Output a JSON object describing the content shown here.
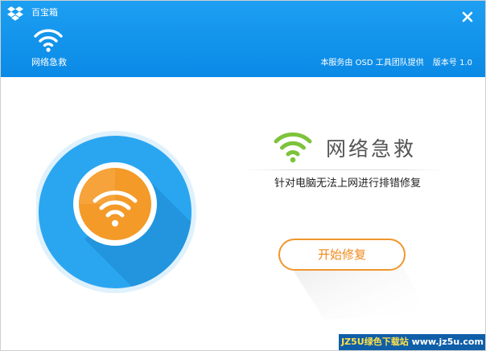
{
  "window": {
    "title": "百宝箱",
    "logo_icon": "dropbox-style-box-icon",
    "close_icon": "close-icon"
  },
  "header": {
    "tool": {
      "icon": "wifi-icon",
      "label": "网络急救"
    },
    "service_note": "本服务由 OSD 工具团队提供",
    "version": "版本号 1.0"
  },
  "main": {
    "title": "网络急救",
    "title_icon": "wifi-signal-icon",
    "description": "针对电脑无法上网进行排错修复",
    "start_button": "开始修复",
    "illustration_icon": "wifi-orange-circle-icon"
  },
  "watermark": {
    "brand": "JZ5U绿色下载站",
    "url": "www.jz5u.com"
  },
  "colors": {
    "header_blue": "#0e8fe8",
    "circle_blue": "#2aa6f0",
    "accent_orange": "#f39a28",
    "wifi_green": "#7dc33b"
  }
}
